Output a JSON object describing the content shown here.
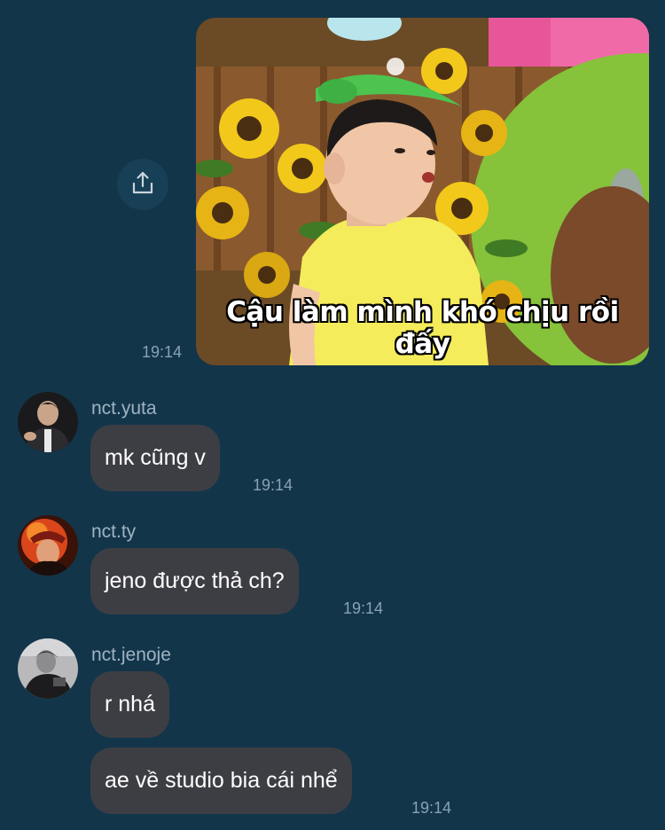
{
  "media_message": {
    "caption": "Cậu làm mình khó chịu rồi đấy",
    "time": "19:14",
    "share_icon": "share-icon"
  },
  "messages": [
    {
      "username": "nct.yuta",
      "text": "mk cũng v",
      "time": "19:14"
    },
    {
      "username": "nct.ty",
      "text": "jeno được thả ch?",
      "time": "19:14"
    },
    {
      "username": "nct.jenoje",
      "texts": [
        "r nhá",
        "ae về studio bia cái nhể"
      ],
      "time": "19:14"
    }
  ],
  "colors": {
    "background": "#12354a",
    "bubble": "#3d3e44",
    "username": "#9fb3c1",
    "timestamp": "#8aa2b2"
  }
}
